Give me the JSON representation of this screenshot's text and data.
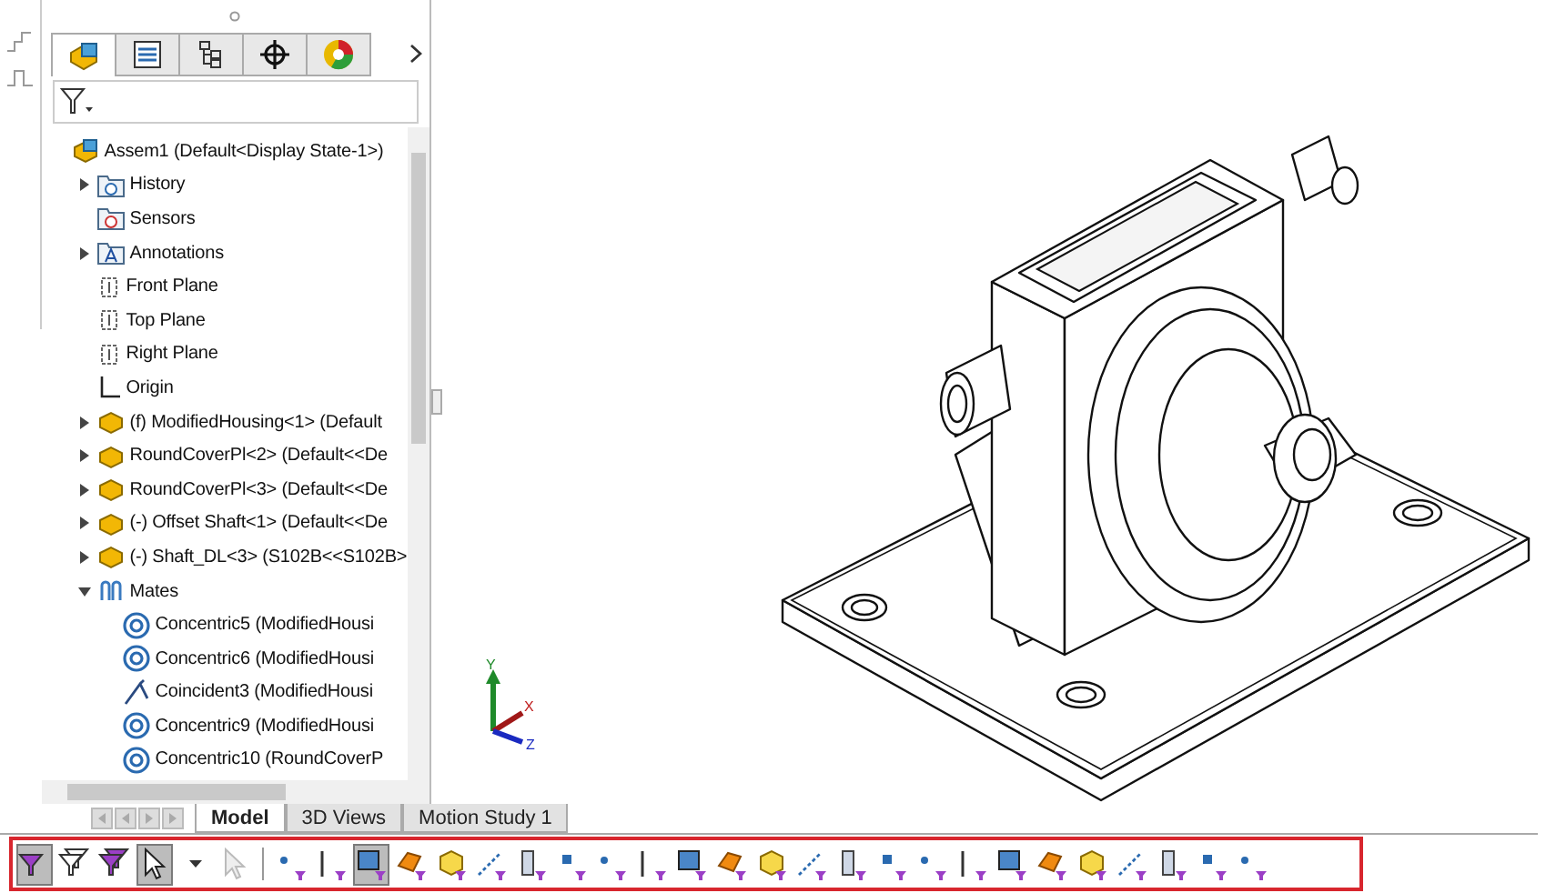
{
  "panel": {
    "tabs": [
      {
        "selected": true
      },
      {
        "selected": false
      },
      {
        "selected": false
      },
      {
        "selected": false
      },
      {
        "selected": false
      }
    ],
    "tree": [
      {
        "label": "Assem1  (Default<Display State-1>)",
        "kind": "assembly",
        "children": [
          {
            "label": "History",
            "kind": "history",
            "expanded": false
          },
          {
            "label": "Sensors",
            "kind": "sensors"
          },
          {
            "label": "Annotations",
            "kind": "annotations",
            "expanded": false
          },
          {
            "label": "Front Plane",
            "kind": "plane"
          },
          {
            "label": "Top Plane",
            "kind": "plane"
          },
          {
            "label": "Right Plane",
            "kind": "plane"
          },
          {
            "label": "Origin",
            "kind": "origin"
          },
          {
            "label": "(f) ModifiedHousing<1> (Default",
            "kind": "part",
            "expanded": false
          },
          {
            "label": "RoundCoverPl<2> (Default<<De",
            "kind": "part",
            "expanded": false
          },
          {
            "label": "RoundCoverPl<3> (Default<<De",
            "kind": "part",
            "expanded": false
          },
          {
            "label": "(-) Offset Shaft<1> (Default<<De",
            "kind": "part",
            "expanded": false
          },
          {
            "label": "(-) Shaft_DL<3> (S102B<<S102B>",
            "kind": "part",
            "expanded": false
          },
          {
            "label": "Mates",
            "kind": "mates",
            "expanded": true,
            "children": [
              {
                "label": "Concentric5 (ModifiedHousi",
                "kind": "concentric"
              },
              {
                "label": "Concentric6 (ModifiedHousi",
                "kind": "concentric"
              },
              {
                "label": "Coincident3 (ModifiedHousi",
                "kind": "coincident"
              },
              {
                "label": "Concentric9 (ModifiedHousi",
                "kind": "concentric"
              },
              {
                "label": "Concentric10 (RoundCoverP",
                "kind": "concentric"
              }
            ]
          }
        ]
      }
    ]
  },
  "view_tabs": [
    {
      "label": "Model",
      "selected": true
    },
    {
      "label": "3D Views",
      "selected": false
    },
    {
      "label": "Motion Study 1",
      "selected": false
    }
  ],
  "triad": {
    "x": "X",
    "y": "Y",
    "z": "Z"
  },
  "toolbar": [
    {
      "kind": "filter",
      "selected": true
    },
    {
      "kind": "filter",
      "selected": false
    },
    {
      "kind": "filter",
      "selected": false
    },
    {
      "kind": "select",
      "selected": true
    },
    {
      "kind": "caret",
      "selected": false
    },
    {
      "kind": "select-disabled",
      "selected": false
    },
    {
      "kind": "entity",
      "selected": false
    },
    {
      "kind": "entity",
      "selected": false
    },
    {
      "kind": "entity",
      "selected": true
    },
    {
      "kind": "entity",
      "selected": false
    },
    {
      "kind": "entity",
      "selected": false
    },
    {
      "kind": "entity",
      "selected": false
    },
    {
      "kind": "entity",
      "selected": false
    },
    {
      "kind": "entity",
      "selected": false
    },
    {
      "kind": "entity",
      "selected": false
    },
    {
      "kind": "entity",
      "selected": false
    },
    {
      "kind": "entity",
      "selected": false
    },
    {
      "kind": "entity",
      "selected": false
    },
    {
      "kind": "entity",
      "selected": false
    },
    {
      "kind": "entity",
      "selected": false
    },
    {
      "kind": "entity",
      "selected": false
    },
    {
      "kind": "entity",
      "selected": false
    },
    {
      "kind": "entity",
      "selected": false
    },
    {
      "kind": "entity",
      "selected": false
    },
    {
      "kind": "entity",
      "selected": false
    },
    {
      "kind": "entity",
      "selected": false
    },
    {
      "kind": "entity",
      "selected": false
    },
    {
      "kind": "entity",
      "selected": false
    },
    {
      "kind": "entity",
      "selected": false
    },
    {
      "kind": "entity",
      "selected": false
    },
    {
      "kind": "entity",
      "selected": false
    }
  ]
}
